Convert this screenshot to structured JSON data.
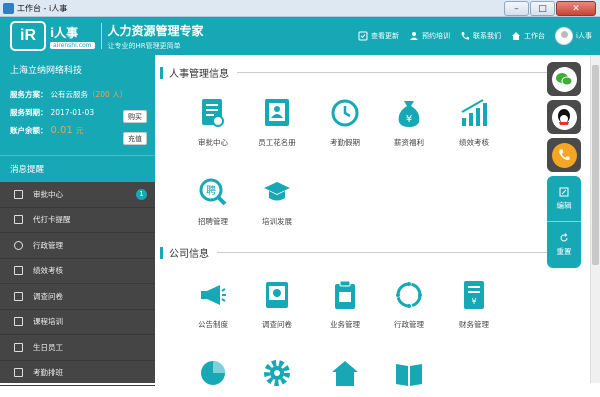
{
  "window": {
    "title": "工作台 - i人事"
  },
  "header": {
    "logo_text": "iR",
    "brand_name": "i人事",
    "brand_domain": "airenshi.com",
    "slogan_title": "人力资源管理专家",
    "slogan_sub": "让专业的HR管理更简单",
    "links": [
      {
        "label": "查看更新",
        "icon": "update-icon"
      },
      {
        "label": "预约培训",
        "icon": "user-group-icon"
      },
      {
        "label": "联系我们",
        "icon": "phone-icon"
      },
      {
        "label": "工作台",
        "icon": "home-icon"
      }
    ],
    "user_name": "i人事"
  },
  "sidebar": {
    "company_name": "上海立纳网络科技",
    "plan_label": "服务方案：",
    "plan_value": "公有云服务",
    "plan_people": "（200 人）",
    "expire_label": "服务到期：",
    "expire_value": "2017-01-03",
    "buy_label": "购买",
    "balance_label": "账户余额：",
    "balance_value": "0.01",
    "balance_unit": "元",
    "recharge_label": "充值",
    "messages_title": "消息提醒",
    "items": [
      {
        "label": "审批中心",
        "badge": "1"
      },
      {
        "label": "代打卡提醒"
      },
      {
        "label": "行政管理"
      },
      {
        "label": "绩效考核"
      },
      {
        "label": "调查问卷"
      },
      {
        "label": "课程培训"
      },
      {
        "label": "生日员工"
      },
      {
        "label": "考勤排班"
      }
    ]
  },
  "main": {
    "hr_section": "人事管理信息",
    "hr_tiles": [
      {
        "label": "审批中心",
        "icon": "approval-doc-icon"
      },
      {
        "label": "员工花名册",
        "icon": "roster-book-icon"
      },
      {
        "label": "考勤假期",
        "icon": "clock-icon"
      },
      {
        "label": "薪资福利",
        "icon": "money-bag-icon"
      },
      {
        "label": "绩效考核",
        "icon": "bar-growth-icon"
      },
      {
        "label": "招聘管理",
        "icon": "recruit-search-icon"
      },
      {
        "label": "培训发展",
        "icon": "graduation-cap-icon"
      }
    ],
    "company_section": "公司信息",
    "company_tiles": [
      {
        "label": "公告制度",
        "icon": "megaphone-icon"
      },
      {
        "label": "调查问卷",
        "icon": "survey-doc-icon"
      },
      {
        "label": "业务管理",
        "icon": "business-clipboard-icon"
      },
      {
        "label": "行政管理",
        "icon": "cycle-arrows-icon"
      },
      {
        "label": "财务管理",
        "icon": "finance-doc-icon"
      }
    ]
  },
  "float_bar": {
    "edit_label": "编辑",
    "reset_label": "重置"
  },
  "colors": {
    "accent": "#16a8b5",
    "dark": "#454545",
    "highlight": "#f3a04d"
  }
}
